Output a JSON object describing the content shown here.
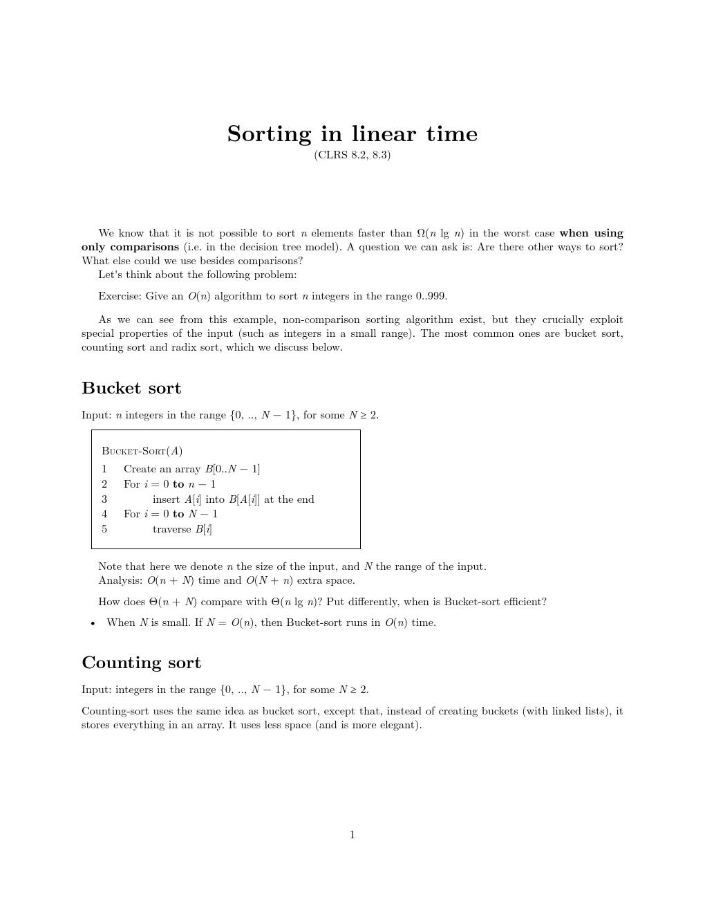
{
  "title": "Sorting in linear time",
  "subtitle": "(CLRS 8.2, 8.3)",
  "p1a": "We know that it is not possible to sort ",
  "p1b": " elements faster than Ω(",
  "p1c": " lg ",
  "p1d": ") in the worst case ",
  "p1e": "when using only comparisons",
  "p1f": " (i.e. in the decision tree model). A question we can ask is: Are there other ways to sort? What else could we use besides comparisons?",
  "p2": "Let's think about the following problem:",
  "ex_a": "Exercise: Give an ",
  "ex_b": "O",
  "ex_c": "(",
  "ex_d": ") algorithm to sort ",
  "ex_e": " integers in the range 0..999.",
  "p3": "As we can see from this example, non-comparison sorting algorithm exist, but they crucially exploit special properties of the input (such as integers in a small range). The most common ones are bucket sort, counting sort and radix sort, which we discuss below.",
  "bucket": {
    "heading": "Bucket sort",
    "input_a": "Input: ",
    "input_b": " integers in the range {0, .., ",
    "input_c": " − 1}, for some ",
    "input_d": " ≥ 2.",
    "algo_name": "Bucket-Sort",
    "algo_arg_open": "(",
    "algo_arg": "A",
    "algo_arg_close": ")",
    "l1_n": "1",
    "l1_a": "Create an array ",
    "l1_b": "B",
    "l1_c": "[0..",
    "l1_d": "N",
    "l1_e": " − 1]",
    "l2_n": "2",
    "l2_a": "For ",
    "l2_b": "i",
    "l2_c": " = 0 ",
    "l2_d": "to",
    "l2_e": " ",
    "l2_f": "n",
    "l2_g": " − 1",
    "l3_n": "3",
    "l3_a": "insert ",
    "l3_b": "A",
    "l3_c": "[",
    "l3_d": "i",
    "l3_e": "] into ",
    "l3_f": "B",
    "l3_g": "[",
    "l3_h": "A",
    "l3_i": "[",
    "l3_j": "i",
    "l3_k": "]] at the end",
    "l4_n": "4",
    "l4_a": "For ",
    "l4_b": "i",
    "l4_c": " = 0 ",
    "l4_d": "to",
    "l4_e": " ",
    "l4_f": "N",
    "l4_g": " − 1",
    "l5_n": "5",
    "l5_a": "traverse ",
    "l5_b": "B",
    "l5_c": "[",
    "l5_d": "i",
    "l5_e": "]",
    "note_a": "Note that here we denote ",
    "note_b": " the size of the input, and ",
    "note_c": " the range of the input.",
    "ana_a": "Analysis: ",
    "ana_b": "O",
    "ana_c": "(",
    "ana_d": " + ",
    "ana_e": ") time and ",
    "ana_f": "O",
    "ana_g": "(",
    "ana_h": " + ",
    "ana_i": ") extra space.",
    "q_a": "How does Θ(",
    "q_b": " + ",
    "q_c": ") compare with Θ(",
    "q_d": " lg ",
    "q_e": ")? Put differently, when is Bucket-sort efficient?",
    "bullet_a": "When ",
    "bullet_b": " is small. If ",
    "bullet_c": " = ",
    "bullet_d": "O",
    "bullet_e": "(",
    "bullet_f": "), then Bucket-sort runs in ",
    "bullet_g": "O",
    "bullet_h": "(",
    "bullet_i": ") time."
  },
  "counting": {
    "heading": "Counting sort",
    "input_a": "Input: integers in the range {0, .., ",
    "input_b": " − 1}, for some ",
    "input_c": " ≥ 2.",
    "p_a": "Counting-sort uses the same idea as bucket sort, except that, instead of creating buckets (with linked lists), it stores everything in an array. It uses less space (and is more elegant)."
  },
  "sym": {
    "n": "n",
    "N": "N",
    "i": "i",
    "A": "A",
    "B": "B"
  },
  "page_number": "1"
}
